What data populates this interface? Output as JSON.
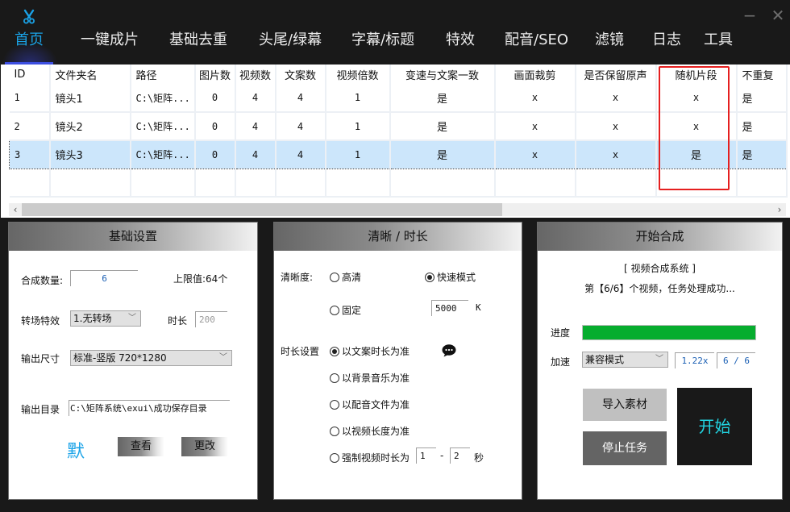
{
  "app": {
    "logo_icon": "scissors-icon",
    "window_controls": {
      "minimize": "−",
      "close": "✕"
    }
  },
  "nav": {
    "active_index": 0,
    "items": [
      "首页",
      "一键成片",
      "基础去重",
      "头尾/绿幕",
      "字幕/标题",
      "特效",
      "配音/SEO",
      "滤镜",
      "日志",
      "工具"
    ]
  },
  "table": {
    "columns": [
      "ID",
      "文件夹名",
      "路径",
      "图片数",
      "视频数",
      "文案数",
      "视频倍数",
      "变速与文案一致",
      "画面裁剪",
      "是否保留原声",
      "随机片段",
      "不重复"
    ],
    "rows": [
      [
        "1",
        "镜头1",
        "C:\\矩阵...",
        "0",
        "4",
        "4",
        "1",
        "是",
        "x",
        "x",
        "x",
        "是"
      ],
      [
        "2",
        "镜头2",
        "C:\\矩阵...",
        "0",
        "4",
        "4",
        "1",
        "是",
        "x",
        "x",
        "x",
        "是"
      ],
      [
        "3",
        "镜头3",
        "C:\\矩阵...",
        "0",
        "4",
        "4",
        "1",
        "是",
        "x",
        "x",
        "是",
        "是"
      ]
    ],
    "selected_row": 2,
    "highlighted_column": "随机片段",
    "scroll": {
      "left_arrow": "‹",
      "right_arrow": "›",
      "thumb_fraction": 0.64
    }
  },
  "basic": {
    "title": "基础设置",
    "count_label": "合成数量:",
    "count_value": "6",
    "limit_label": "上限值:64个",
    "transition_label": "转场特效",
    "transition_value": "1.无转场",
    "duration_label": "时长",
    "duration_placeholder": "200",
    "size_label": "输出尺寸",
    "size_value": "标准-竖版 720*1280",
    "outdir_label": "输出目录",
    "outdir_value": "C:\\矩阵系统\\exui\\成功保存目录",
    "default_label": "默",
    "view_button": "查看",
    "change_button": "更改"
  },
  "clarity": {
    "title": "清晰 / 时长",
    "clarity_label": "清晰度:",
    "options": [
      {
        "label": "高清",
        "checked": false
      },
      {
        "label": "快速模式",
        "checked": true
      },
      {
        "label": "固定",
        "checked": false
      }
    ],
    "bitrate_value": "5000",
    "bitrate_unit": "K",
    "duration_label": "时长设置",
    "duration_options": [
      {
        "label": "以文案时长为准",
        "checked": true
      },
      {
        "label": "以背景音乐为准",
        "checked": false
      },
      {
        "label": "以配音文件为准",
        "checked": false
      },
      {
        "label": "以视频长度为准",
        "checked": false
      },
      {
        "label": "强制视频时长为",
        "checked": false
      }
    ],
    "force_min": "1",
    "force_dash": "-",
    "force_max": "2",
    "force_unit": "秒",
    "help_icon": "chat-bubble-icon"
  },
  "synth": {
    "title": "开始合成",
    "system_label": "[ 视频合成系统 ]",
    "status_text": "第【6/6】个视频，任务处理成功...",
    "progress_label": "进度",
    "progress_percent": 100,
    "accel_label": "加速",
    "accel_value": "兼容模式",
    "speed_value": "1.22x",
    "count_value": "6 / 6",
    "import_button": "导入素材",
    "stop_button": "停止任务",
    "start_button": "开始"
  },
  "colors": {
    "accent": "#1aa3e8",
    "progress": "#06ad2e",
    "selection": "#cce6fb",
    "highlight_frame": "#e51f1f",
    "start_text": "#22d3e0"
  }
}
